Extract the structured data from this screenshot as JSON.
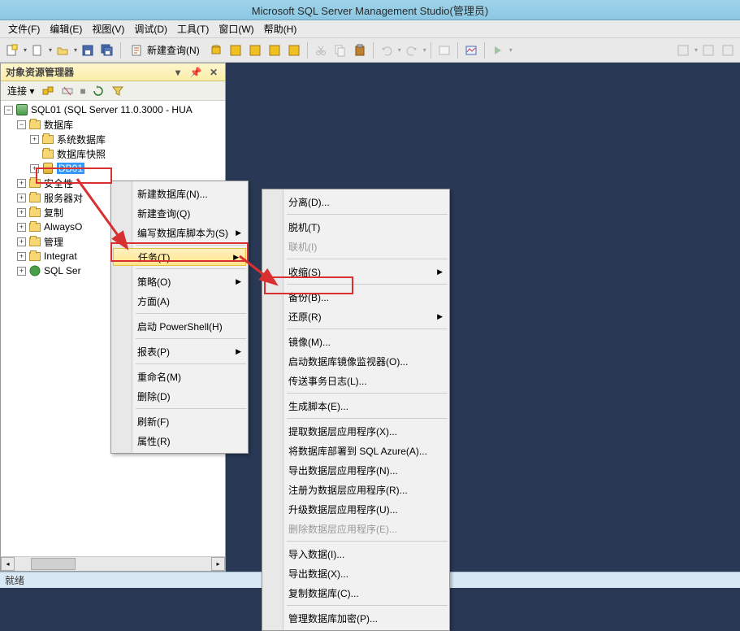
{
  "title": "Microsoft SQL Server Management Studio(管理员)",
  "menubar": [
    "文件(F)",
    "编辑(E)",
    "视图(V)",
    "调试(D)",
    "工具(T)",
    "窗口(W)",
    "帮助(H)"
  ],
  "toolbar": {
    "new_query": "新建查询(N)"
  },
  "panel": {
    "title": "对象资源管理器",
    "connect_label": "连接",
    "root": "SQL01 (SQL Server 11.0.3000 - HUA",
    "folders": {
      "databases": "数据库",
      "sysdb": "系统数据库",
      "snapshots": "数据库快照",
      "db01": "DB01",
      "security": "安全性",
      "server_objects": "服务器对",
      "replication": "复制",
      "alwayson": "AlwaysO",
      "management": "管理",
      "integration": "Integrat",
      "sql_server": "SQL Ser"
    }
  },
  "context_menu_1": {
    "new_database": "新建数据库(N)...",
    "new_query": "新建查询(Q)",
    "script_db_as": "编写数据库脚本为(S)",
    "tasks": "任务(T)",
    "policies": "策略(O)",
    "facets": "方面(A)",
    "powershell": "启动 PowerShell(H)",
    "reports": "报表(P)",
    "rename": "重命名(M)",
    "delete": "删除(D)",
    "refresh": "刷新(F)",
    "properties": "属性(R)"
  },
  "context_menu_2": {
    "detach": "分离(D)...",
    "offline": "脱机(T)",
    "online": "联机(I)",
    "shrink": "收缩(S)",
    "backup": "备份(B)...",
    "restore": "还原(R)",
    "mirror": "镜像(M)...",
    "launch_mirror_monitor": "启动数据库镜像监视器(O)...",
    "ship_tx_logs": "传送事务日志(L)...",
    "gen_scripts": "生成脚本(E)...",
    "extract_dta": "提取数据层应用程序(X)...",
    "deploy_azure": "将数据库部署到 SQL Azure(A)...",
    "export_dta": "导出数据层应用程序(N)...",
    "register_dta": "注册为数据层应用程序(R)...",
    "upgrade_dta": "升级数据层应用程序(U)...",
    "delete_dta": "删除数据层应用程序(E)...",
    "import_data": "导入数据(I)...",
    "export_data": "导出数据(X)...",
    "copy_db": "复制数据库(C)...",
    "manage_encrypt": "管理数据库加密(P)..."
  },
  "status": {
    "ready": "就绪"
  }
}
